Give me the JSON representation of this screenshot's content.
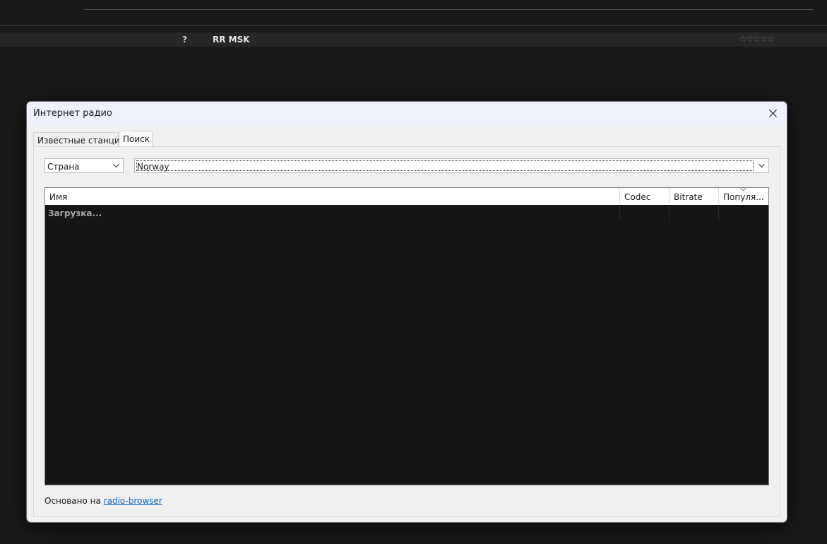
{
  "background": {
    "track": {
      "number": "?",
      "title": "RR MSK",
      "rating": "☆☆☆☆☆"
    }
  },
  "dialog": {
    "title": "Интернет радио",
    "close_icon": "close-icon",
    "tabs": [
      {
        "label": "Известные станции"
      },
      {
        "label": "Поиск",
        "selected": true
      }
    ],
    "search": {
      "filter_type": "Страна",
      "query": "Norway"
    },
    "list": {
      "columns": [
        "Имя",
        "Codec",
        "Bitrate",
        "Популя..."
      ],
      "sorted_column": "Популя...",
      "status": "Загрузка..."
    },
    "footer": {
      "prefix": "Основано на",
      "link": "radio-browser"
    }
  },
  "colors": {
    "app_background": "#191919",
    "dialog_background": "#f0f0f0",
    "list_background": "#151515",
    "link": "#0b65c2"
  }
}
